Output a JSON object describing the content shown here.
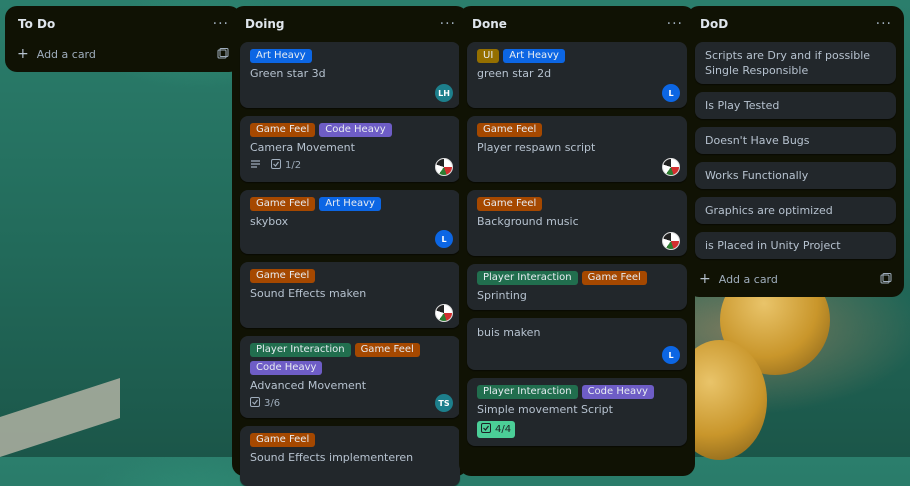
{
  "colors": {
    "art_heavy": "#0c66e4",
    "game_feel": "#a54800",
    "code_heavy": "#6e5dc6",
    "player_interaction": "#216e4e",
    "ui": "#946f00",
    "avatar_lh": "#1d7f8c",
    "avatar_l": "#0c66e4",
    "avatar_ts": "#1d7f8c"
  },
  "lists": {
    "todo": {
      "title": "To Do",
      "add_card": "Add a card"
    },
    "doing": {
      "title": "Doing",
      "cards": [
        {
          "labels": [
            "Art Heavy"
          ],
          "title": "Green star 3d",
          "avatar": "LH"
        },
        {
          "labels": [
            "Game Feel",
            "Code Heavy"
          ],
          "title": "Camera Movement",
          "checklist": "1/2"
        },
        {
          "labels": [
            "Game Feel",
            "Art Heavy"
          ],
          "title": "skybox",
          "avatar": "L"
        },
        {
          "labels": [
            "Game Feel"
          ],
          "title": "Sound Effects maken"
        },
        {
          "labels": [
            "Player Interaction",
            "Game Feel",
            "Code Heavy"
          ],
          "title": "Advanced Movement",
          "checklist": "3/6",
          "avatar": "TS"
        },
        {
          "labels": [
            "Game Feel"
          ],
          "title": "Sound Effects implementeren"
        }
      ]
    },
    "done": {
      "title": "Done",
      "cards": [
        {
          "labels": [
            "UI",
            "Art Heavy"
          ],
          "title": "green star 2d",
          "avatar": "L"
        },
        {
          "labels": [
            "Game Feel"
          ],
          "title": "Player respawn script"
        },
        {
          "labels": [
            "Game Feel"
          ],
          "title": "Background music"
        },
        {
          "labels": [
            "Player Interaction",
            "Game Feel"
          ],
          "title": "Sprinting"
        },
        {
          "title": "buis maken",
          "avatar": "L"
        },
        {
          "labels": [
            "Player Interaction",
            "Code Heavy"
          ],
          "title": "Simple movement Script",
          "checklist": "4/4"
        }
      ]
    },
    "dod": {
      "title": "DoD",
      "cards": [
        "Scripts are Dry and if possible Single Responsible",
        "Is Play Tested",
        "Doesn't Have Bugs",
        "Works Functionally",
        "Graphics are optimized",
        "is Placed in Unity Project"
      ],
      "add_card": "Add a card"
    }
  },
  "icons": {
    "list_menu": "···",
    "plus": "+",
    "template": "template-icon",
    "description": "description-icon",
    "checklist": "checklist-icon"
  }
}
